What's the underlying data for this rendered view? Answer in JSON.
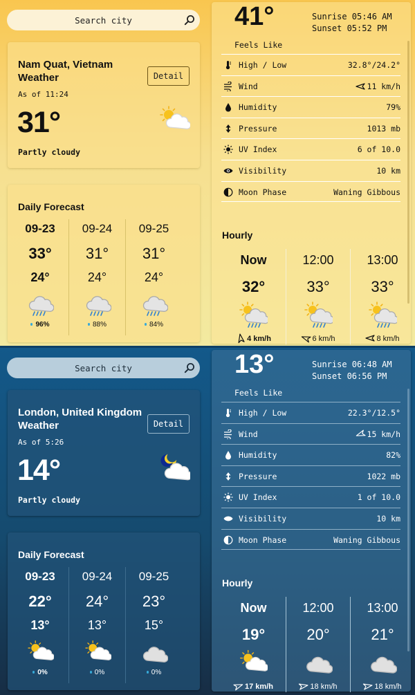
{
  "panels": [
    {
      "theme": "day",
      "search": {
        "placeholder": "Search city"
      },
      "current": {
        "location": "Nam Quat, Vietnam Weather",
        "as_of": "As of 11:24",
        "temp": "31°",
        "condition": "Partly cloudy",
        "detail_label": "Detail",
        "icon": "partly-cloudy-day-icon"
      },
      "daily": {
        "title": "Daily Forecast",
        "days": [
          {
            "date": "09-23",
            "high": "33°",
            "low": "24°",
            "precip": "96%",
            "icon": "rain-cloud-icon"
          },
          {
            "date": "09-24",
            "high": "31°",
            "low": "24°",
            "precip": "88%",
            "icon": "rain-cloud-icon"
          },
          {
            "date": "09-25",
            "high": "31°",
            "low": "24°",
            "precip": "84%",
            "icon": "rain-cloud-icon"
          }
        ]
      },
      "details": {
        "temp": "41°",
        "sunrise": "Sunrise 05:46 AM",
        "sunset": "Sunset 05:52 PM",
        "feels_like": "Feels Like",
        "rows": [
          {
            "label": "High / Low",
            "value": "32.8°/24.2°",
            "icon": "thermometer-icon"
          },
          {
            "label": "Wind",
            "value": "11 km/h",
            "icon": "wind-icon"
          },
          {
            "label": "Humidity",
            "value": "79%",
            "icon": "humidity-drop-icon"
          },
          {
            "label": "Pressure",
            "value": "1013 mb",
            "icon": "pressure-icon"
          },
          {
            "label": "UV Index",
            "value": "6 of 10.0",
            "icon": "uv-sun-icon"
          },
          {
            "label": "Visibility",
            "value": "10 km",
            "icon": "eye-icon"
          },
          {
            "label": "Moon Phase",
            "value": "Waning Gibbous",
            "icon": "moon-phase-icon"
          }
        ]
      },
      "hourly": {
        "title": "Hourly",
        "hours": [
          {
            "time": "Now",
            "temp": "32°",
            "wind": "4 km/h",
            "icon": "rain-sun-cloud-icon"
          },
          {
            "time": "12:00",
            "temp": "33°",
            "wind": "6 km/h",
            "icon": "rain-sun-cloud-icon"
          },
          {
            "time": "13:00",
            "temp": "33°",
            "wind": "8 km/h",
            "icon": "rain-sun-cloud-icon"
          }
        ]
      }
    },
    {
      "theme": "night",
      "search": {
        "placeholder": "Search city"
      },
      "current": {
        "location": "London, United Kingdom Weather",
        "as_of": "As of 5:26",
        "temp": "14°",
        "condition": "Partly cloudy",
        "detail_label": "Detail",
        "icon": "partly-cloudy-night-icon"
      },
      "daily": {
        "title": "Daily Forecast",
        "days": [
          {
            "date": "09-23",
            "high": "22°",
            "low": "13°",
            "precip": "0%",
            "icon": "partly-cloudy-day-icon"
          },
          {
            "date": "09-24",
            "high": "24°",
            "low": "13°",
            "precip": "0%",
            "icon": "partly-cloudy-day-icon"
          },
          {
            "date": "09-25",
            "high": "23°",
            "low": "15°",
            "precip": "0%",
            "icon": "cloud-icon"
          }
        ]
      },
      "details": {
        "temp": "13°",
        "sunrise": "Sunrise 06:48 AM",
        "sunset": "Sunset 06:56 PM",
        "feels_like": "Feels Like",
        "rows": [
          {
            "label": "High / Low",
            "value": "22.3°/12.5°",
            "icon": "thermometer-icon"
          },
          {
            "label": "Wind",
            "value": "15 km/h",
            "icon": "wind-icon"
          },
          {
            "label": "Humidity",
            "value": "82%",
            "icon": "humidity-drop-icon"
          },
          {
            "label": "Pressure",
            "value": "1022 mb",
            "icon": "pressure-icon"
          },
          {
            "label": "UV Index",
            "value": "1 of 10.0",
            "icon": "uv-sun-icon"
          },
          {
            "label": "Visibility",
            "value": "10 km",
            "icon": "eye-icon"
          },
          {
            "label": "Moon Phase",
            "value": "Waning Gibbous",
            "icon": "moon-phase-icon"
          }
        ]
      },
      "hourly": {
        "title": "Hourly",
        "hours": [
          {
            "time": "Now",
            "temp": "19°",
            "wind": "17 km/h",
            "icon": "partly-cloudy-day-icon"
          },
          {
            "time": "12:00",
            "temp": "20°",
            "wind": "18 km/h",
            "icon": "cloud-icon"
          },
          {
            "time": "13:00",
            "temp": "21°",
            "wind": "18 km/h",
            "icon": "cloud-icon"
          }
        ]
      }
    }
  ]
}
